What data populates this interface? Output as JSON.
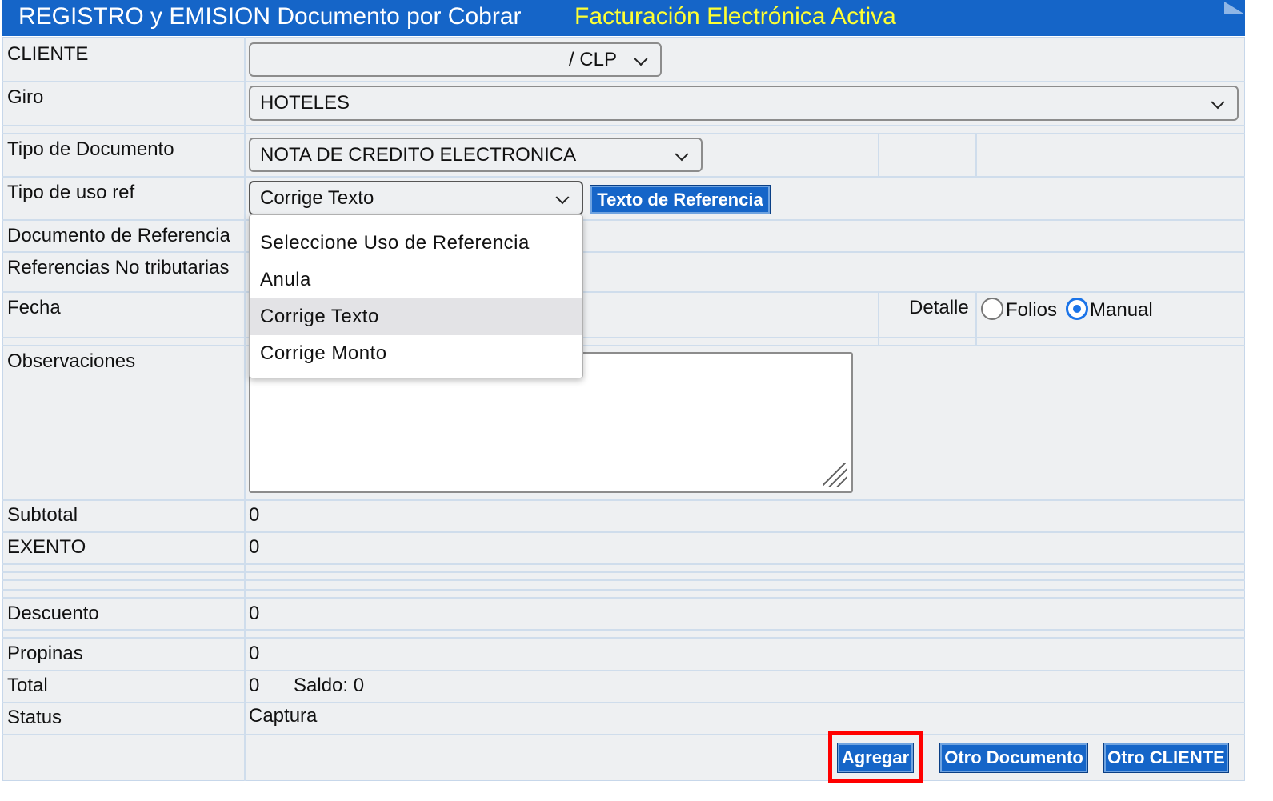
{
  "header": {
    "title": "REGISTRO y EMISION Documento por Cobrar",
    "subtitle": "Facturación Electrónica Activa",
    "title_color": "#ffffff",
    "subtitle_color": "#ffff33",
    "bg_color": "#1565c8"
  },
  "form": {
    "cliente": {
      "label": "CLIENTE",
      "value": "/ CLP"
    },
    "giro": {
      "label": "Giro",
      "value": "HOTELES"
    },
    "tipo_documento": {
      "label": "Tipo de Documento",
      "value": "NOTA DE CREDITO ELECTRONICA"
    },
    "tipo_uso_ref": {
      "label": "Tipo de uso ref",
      "value": "Corrige Texto",
      "button": "Texto de Referencia"
    },
    "documento_referencia": {
      "label": "Documento de Referencia"
    },
    "referencias_no_tributarias": {
      "label": "Referencias No tributarias"
    },
    "fecha": {
      "label": "Fecha"
    },
    "detalle": {
      "label": "Detalle",
      "options": [
        "Folios",
        "Manual"
      ],
      "selected": "Manual"
    },
    "observaciones": {
      "label": "Observaciones",
      "value": ""
    },
    "subtotal": {
      "label": "Subtotal",
      "value": "0"
    },
    "exento": {
      "label": "EXENTO",
      "value": "0"
    },
    "descuento": {
      "label": "Descuento",
      "value": "0"
    },
    "propinas": {
      "label": "Propinas",
      "value": "0"
    },
    "total": {
      "label": "Total",
      "value": "0",
      "saldo": "Saldo: 0"
    },
    "status": {
      "label": "Status",
      "value": "Captura"
    }
  },
  "dropdown": {
    "options": [
      "Seleccione Uso de Referencia",
      "Anula",
      "Corrige Texto",
      "Corrige Monto"
    ],
    "selected": "Corrige Texto"
  },
  "buttons": {
    "agregar": "Agregar",
    "otro_documento": "Otro Documento",
    "otro_cliente": "Otro CLIENTE"
  },
  "highlight_color": "#ff0000"
}
